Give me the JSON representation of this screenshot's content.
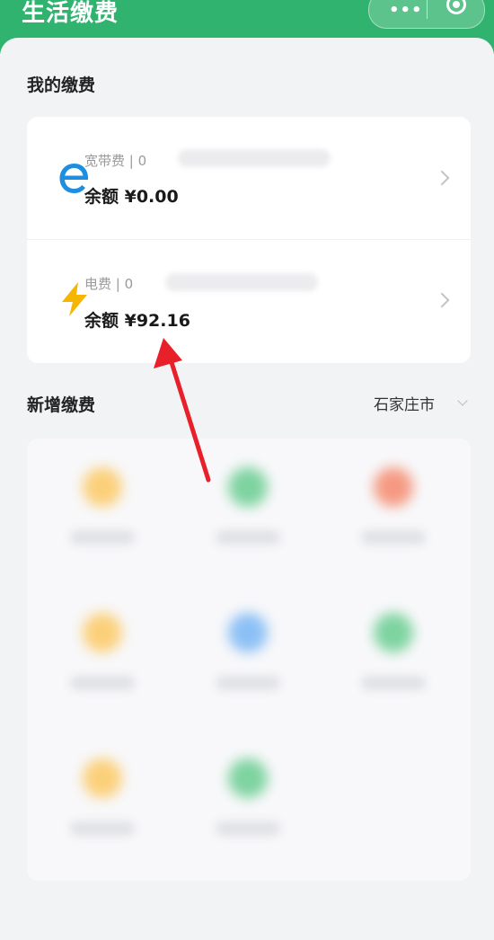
{
  "header": {
    "title": "生活缴费",
    "menu_glyph": "•••"
  },
  "my_payments": {
    "title": "我的缴费",
    "items": [
      {
        "label": "宽带费 | 0",
        "balance": "余额 ¥0.00",
        "icon": "broadband-e-icon",
        "color": "#1e8fe0"
      },
      {
        "label": "电费 | 0",
        "balance": "余额 ¥92.16",
        "icon": "lightning-icon",
        "color": "#f6b500"
      }
    ]
  },
  "new_payment": {
    "title": "新增缴费",
    "city": "石家庄市"
  },
  "grid": {
    "dot_colors": [
      "#fbd07a",
      "#7ed3a0",
      "#f59a82",
      "#fbd07a",
      "#8cc0f5",
      "#7ed3a0",
      "#fbd07a",
      "#7ed3a0"
    ]
  },
  "annotation": {
    "arrow_color": "#e8202a"
  }
}
